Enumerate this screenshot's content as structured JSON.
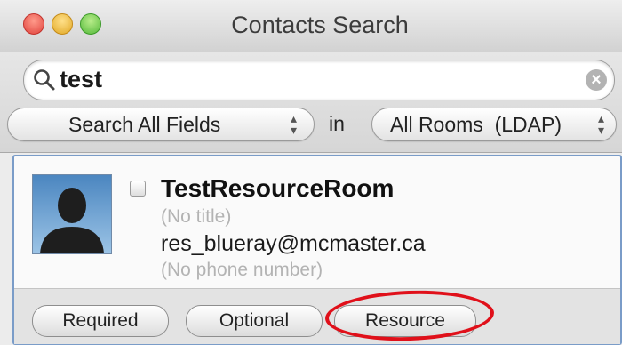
{
  "window": {
    "title": "Contacts Search",
    "traffic_lights": [
      "close",
      "minimize",
      "zoom"
    ]
  },
  "search": {
    "value": "test",
    "icon": "magnifier-icon",
    "clear_icon": "clear-icon"
  },
  "filters": {
    "fields_selected": "Search All Fields",
    "in_label": "in",
    "scope_selected": "All Rooms  (LDAP)"
  },
  "contact": {
    "name": "TestResourceRoom",
    "title": "(No title)",
    "email": "res_blueray@mcmaster.ca",
    "phone": "(No phone number)",
    "avatar_icon": "person-silhouette-icon"
  },
  "buttons": {
    "required": "Required",
    "optional": "Optional",
    "resource": "Resource"
  },
  "colors": {
    "highlight": "#e0101a",
    "card_border": "#7a9cc8"
  }
}
